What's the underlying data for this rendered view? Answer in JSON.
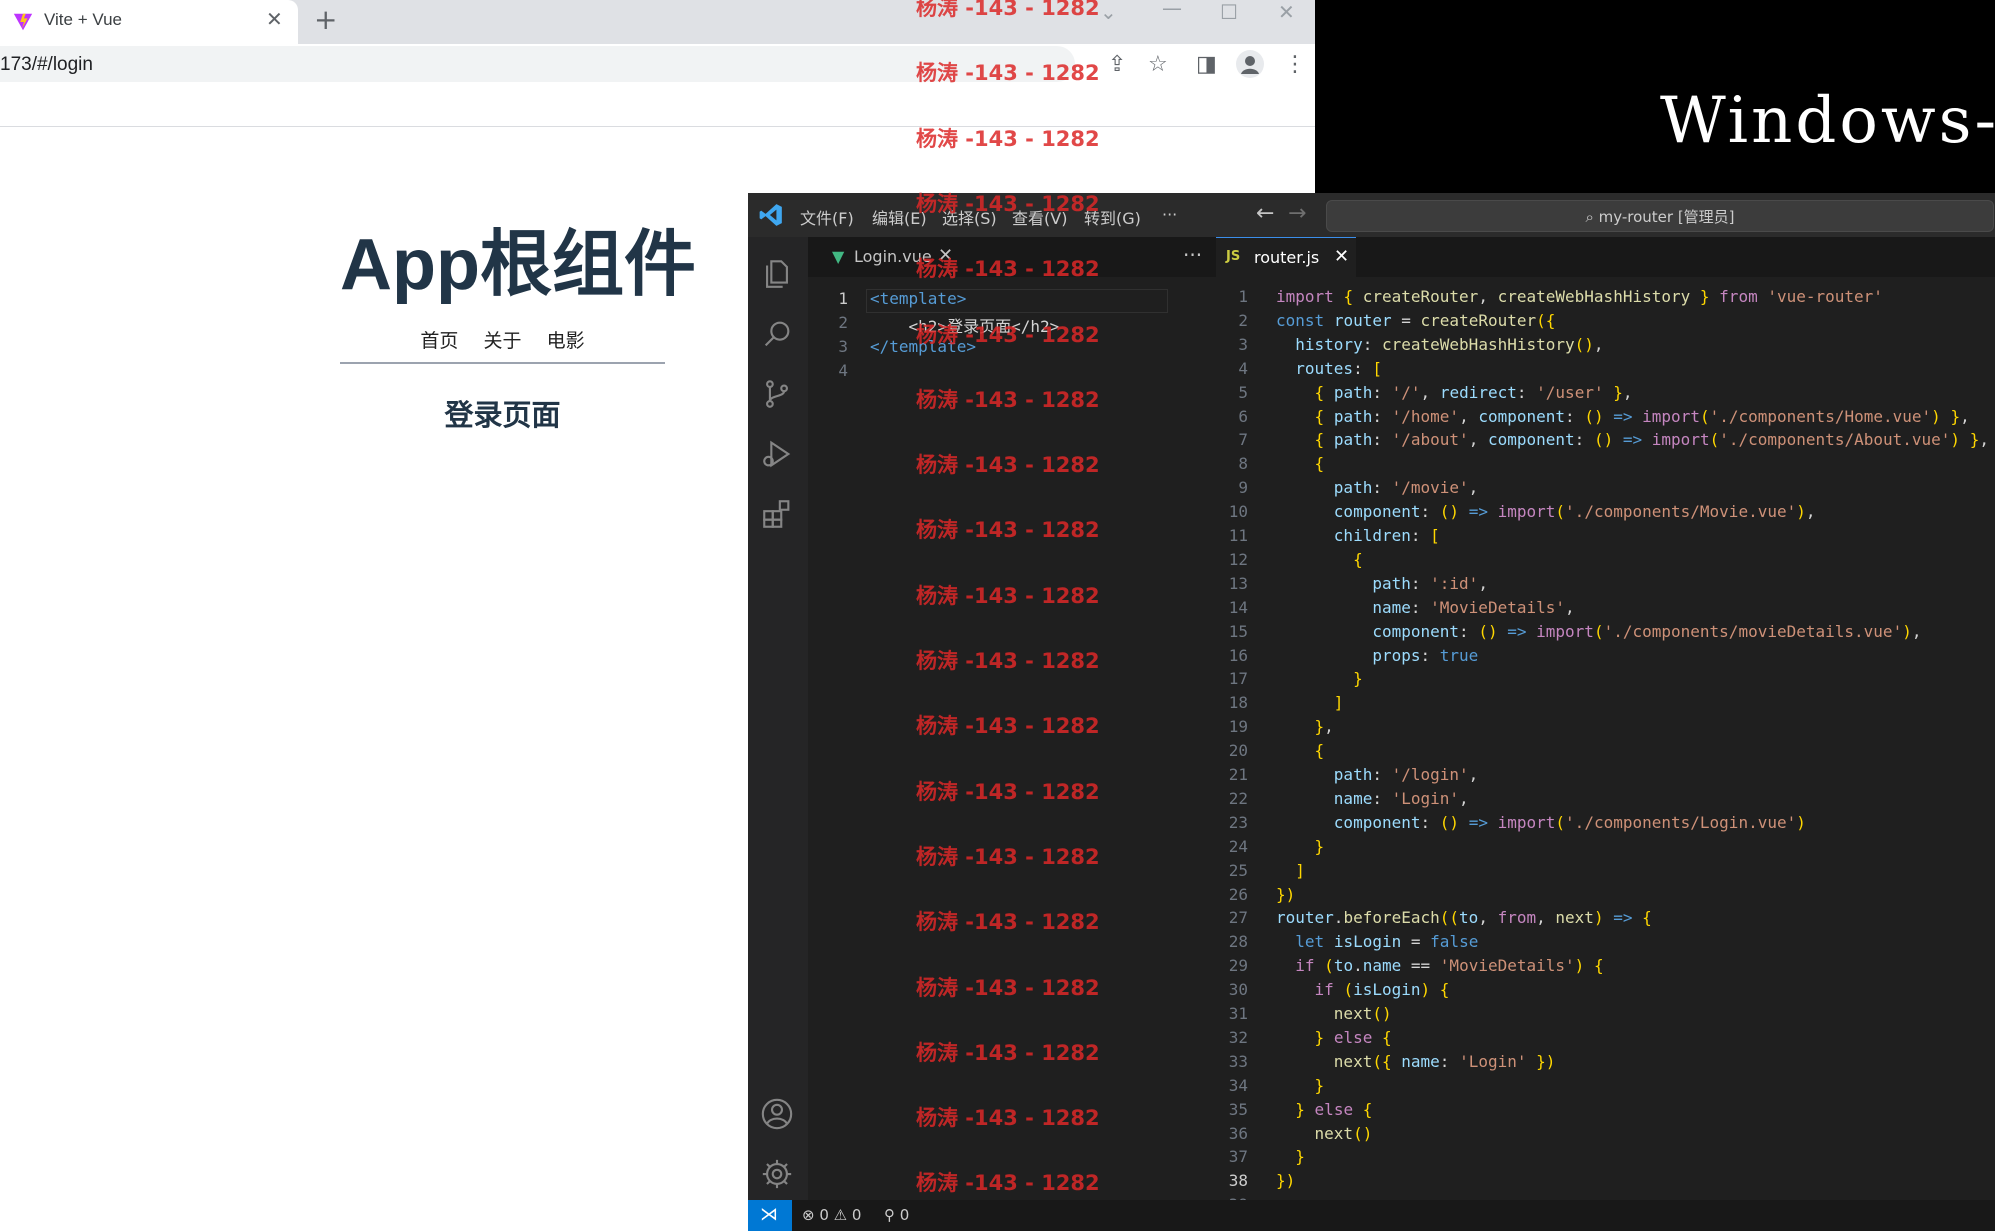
{
  "browser": {
    "tab_title": "Vite + Vue",
    "tab_close": "✕",
    "new_tab": "+",
    "url": "173/#/login",
    "page": {
      "title": "App根组件",
      "nav": [
        "首页",
        "关于",
        "电影"
      ],
      "subtitle": "登录页面"
    }
  },
  "overlay": {
    "text": "Windows-"
  },
  "watermark": "杨涛 -143 - 1282",
  "vscode": {
    "menu": [
      "文件(F)",
      "编辑(E)",
      "选择(S)",
      "查看(V)",
      "转到(G)",
      "···"
    ],
    "command_center": "⌕ my-router [管理员]",
    "tabs": {
      "login": "Login.vue",
      "router": "router.js",
      "router_badge": "JS"
    },
    "status": {
      "problems": "⊗ 0 ⚠ 0",
      "ports": "⚲ 0"
    },
    "login_code": [
      "<template>",
      "    <h2>登录页面</h2>",
      "</template>",
      ""
    ],
    "router_code": [
      "import { createRouter, createWebHashHistory } from 'vue-router'",
      "const router = createRouter({",
      "  history: createWebHashHistory(),",
      "  routes: [",
      "    { path: '/', redirect: '/user' },",
      "    { path: '/home', component: () => import('./components/Home.vue') },",
      "    { path: '/about', component: () => import('./components/About.vue') },",
      "    {",
      "      path: '/movie',",
      "      component: () => import('./components/Movie.vue'),",
      "      children: [",
      "        {",
      "          path: ':id',",
      "          name: 'MovieDetails',",
      "          component: () => import('./components/movieDetails.vue'),",
      "          props: true",
      "        }",
      "      ]",
      "    },",
      "    {",
      "      path: '/login',",
      "      name: 'Login',",
      "      component: () => import('./components/Login.vue')",
      "    }",
      "  ]",
      "})",
      "router.beforeEach((to, from, next) => {",
      "  let isLogin = false",
      "  if (to.name == 'MovieDetails') {",
      "    if (isLogin) {",
      "      next()",
      "    } else {",
      "      next({ name: 'Login' })",
      "    }",
      "  } else {",
      "    next()",
      "  }",
      "})",
      ""
    ]
  },
  "colors": {
    "vscode_bg": "#1e1e1e",
    "accent": "#0078d4",
    "watermark": "#dc2828",
    "vue_green": "#42b883"
  }
}
